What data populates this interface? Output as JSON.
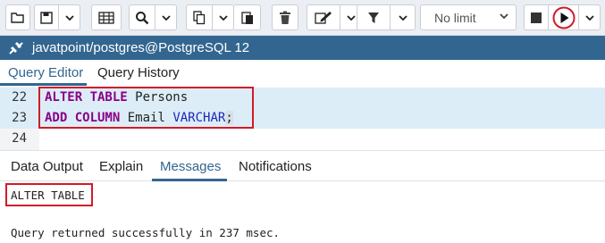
{
  "toolbar": {
    "buttons": [
      {
        "name": "open-file-icon"
      },
      {
        "name": "save-icon"
      },
      {
        "name": "grid-edit-icon"
      },
      {
        "name": "search-icon"
      },
      {
        "name": "copy-icon"
      },
      {
        "name": "paste-icon"
      },
      {
        "name": "delete-icon"
      },
      {
        "name": "edit-icon"
      },
      {
        "name": "filter-icon"
      },
      {
        "name": "stop-icon"
      },
      {
        "name": "execute-play-icon"
      }
    ],
    "limit_label": "No limit"
  },
  "connection": {
    "label": "javatpoint/postgres@PostgreSQL 12",
    "icon": "plug-icon"
  },
  "tabs": {
    "query_editor": "Query Editor",
    "query_history": "Query History"
  },
  "editor": {
    "lines": [
      {
        "num": "22",
        "kw1": "ALTER TABLE",
        "rest": " Persons"
      },
      {
        "num": "23",
        "kw1": "ADD COLUMN",
        "mid": " Email ",
        "type": "VARCHAR",
        "end": ";"
      },
      {
        "num": "24"
      }
    ]
  },
  "results_tabs": {
    "data_output": "Data Output",
    "explain": "Explain",
    "messages": "Messages",
    "notifications": "Notifications"
  },
  "messages": {
    "result": "ALTER TABLE",
    "status": "Query returned successfully in 237 msec."
  },
  "colors": {
    "accent": "#326690",
    "highlight_box": "#d11b27",
    "keyword": "#8a0087",
    "type": "#1f27b6"
  }
}
